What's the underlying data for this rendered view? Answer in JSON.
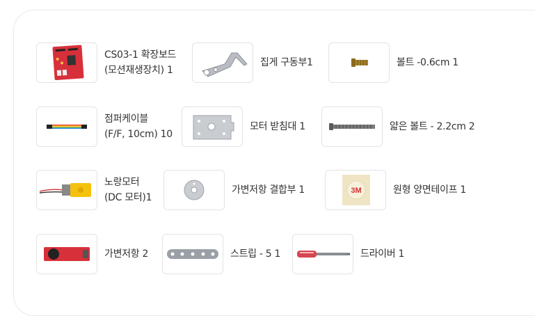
{
  "items": [
    {
      "icon": "expansion-board-icon",
      "label_1": "CS03-1 확장보드",
      "label_2": "(모션재생장치) 1"
    },
    {
      "icon": "pincer-driver-icon",
      "label_1": "집게 구동부1"
    },
    {
      "icon": "bolt-short-icon",
      "label_1": "볼트 -0.6cm 1"
    },
    {
      "icon": "jumper-cable-icon",
      "label_1": "점퍼케이블",
      "label_2": "(F/F, 10cm) 10"
    },
    {
      "icon": "motor-holder-icon",
      "label_1": "모터 받침대 1"
    },
    {
      "icon": "bolt-long-icon",
      "label_1": "얇은 볼트 - 2.2cm 2"
    },
    {
      "icon": "yellow-motor-icon",
      "label_1": "노랑모터",
      "label_2": "(DC 모터)1"
    },
    {
      "icon": "potentiometer-coupler-icon",
      "label_1": "가변저항 결합부 1"
    },
    {
      "icon": "double-sided-tape-icon",
      "label_1": "원형 양면테이프 1"
    },
    {
      "icon": "potentiometer-icon",
      "label_1": "가변저항 2"
    },
    {
      "icon": "strip-icon",
      "label_1": "스트립 - 5 1"
    },
    {
      "icon": "screwdriver-icon",
      "label_1": "드라이버 1"
    }
  ]
}
